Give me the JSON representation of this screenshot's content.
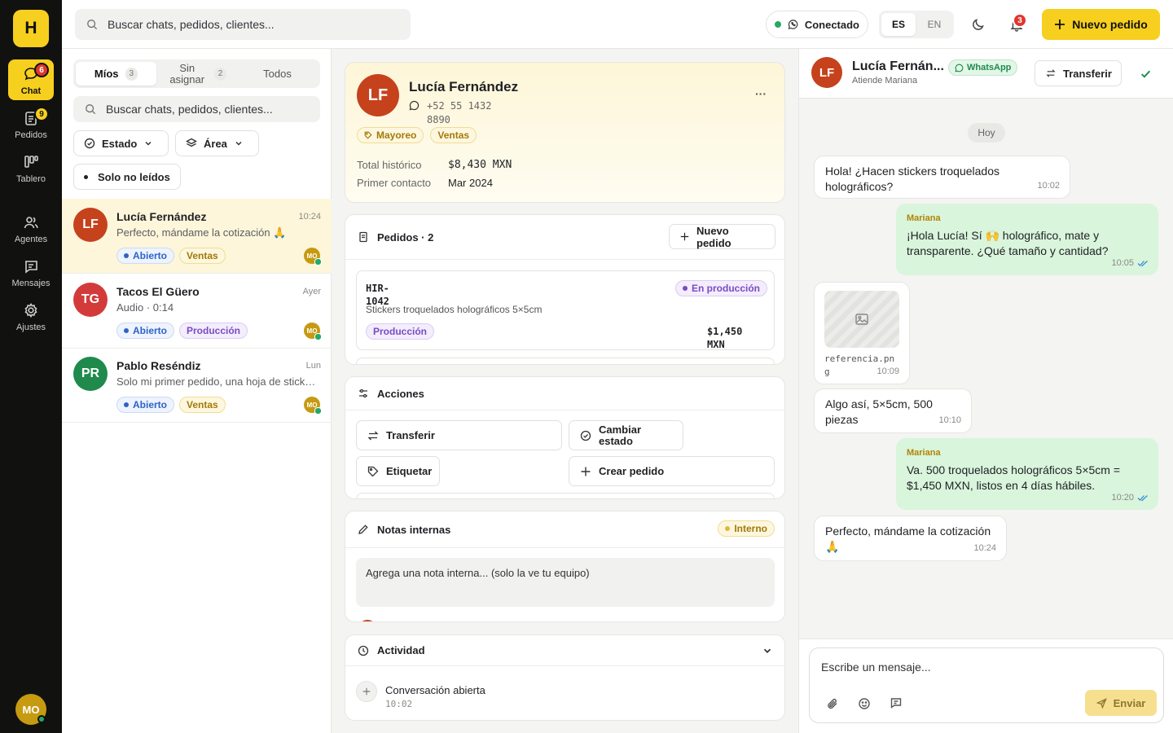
{
  "colors": {
    "accent": "#f7cf1f",
    "rail_bg": "#111110",
    "whatsapp": "#25a866"
  },
  "rail": {
    "logo": "H",
    "items": [
      {
        "label": "Chat",
        "icon": "chat-bubble-icon",
        "badge": "6"
      },
      {
        "label": "Pedidos",
        "icon": "clipboard-icon",
        "badge": "9"
      },
      {
        "label": "Tablero",
        "icon": "kanban-icon"
      },
      {
        "label": "Agentes",
        "icon": "users-icon"
      },
      {
        "label": "Mensajes",
        "icon": "message-square-icon"
      },
      {
        "label": "Ajustes",
        "icon": "gear-icon"
      }
    ],
    "user_initials": "MO"
  },
  "topbar": {
    "search_placeholder": "Buscar chats, pedidos, clientes...",
    "status_label": "Conectado",
    "lang_es": "ES",
    "lang_en": "EN",
    "notifications_count": "3",
    "new_order_label": "Nuevo pedido"
  },
  "list": {
    "tabs": [
      {
        "label": "Míos",
        "count": "3"
      },
      {
        "label": "Sin asignar",
        "count": "2"
      },
      {
        "label": "Todos"
      }
    ],
    "search_placeholder": "Buscar chats, pedidos, clientes...",
    "filter_estado": "Estado",
    "filter_area": "Área",
    "filter_unread": "Solo no leídos",
    "conversations": [
      {
        "initials": "LF",
        "name": "Lucía Fernández",
        "time": "10:24",
        "preview": "Perfecto, mándame la cotización 🙏",
        "status": "Abierto",
        "area": "Ventas",
        "agent": "MO",
        "color": "#c5421d"
      },
      {
        "initials": "TG",
        "name": "Tacos El Güero",
        "time": "Ayer",
        "preview": "Audio · 0:14",
        "status": "Abierto",
        "area": "Producción",
        "agent": "MO",
        "color": "#d33b3b"
      },
      {
        "initials": "PR",
        "name": "Pablo Reséndiz",
        "time": "Lun",
        "preview": "Solo mi primer pedido, una hoja de stickers de prueba",
        "status": "Abierto",
        "area": "Ventas",
        "agent": "MO",
        "color": "#1f8a4c"
      }
    ]
  },
  "customer": {
    "initials": "LF",
    "name": "Lucía Fernández",
    "phone_line1": "+52 55 1432",
    "phone_line2": "8890",
    "tags": [
      "Mayoreo",
      "Ventas"
    ],
    "total_label": "Total histórico",
    "total_value": "$8,430 MXN",
    "first_label": "Primer contacto",
    "first_value": "Mar 2024",
    "more": "···"
  },
  "orders": {
    "title": "Pedidos · 2",
    "new_label": "Nuevo pedido",
    "item": {
      "id_line1": "HIR-",
      "id_line2": "1042",
      "status": "En producción",
      "desc": "Stickers troquelados holográficos 5×5cm",
      "area": "Producción",
      "price_line1": "$1,450",
      "price_line2": "MXN"
    }
  },
  "actions": {
    "title": "Acciones",
    "transfer": "Transferir",
    "change_state_line1": "Cambiar",
    "change_state_line2": "estado",
    "tag": "Etiquetar",
    "create_order": "Crear pedido"
  },
  "notes": {
    "title": "Notas internas",
    "badge": "Interno",
    "placeholder": "Agrega una nota interna... (solo la ve tu equipo)"
  },
  "activity": {
    "title": "Actividad",
    "event": "Conversación abierta",
    "time": "10:02"
  },
  "chat": {
    "name": "Lucía Fernán...",
    "channel": "WhatsApp",
    "agent_line": "Atiende Mariana",
    "transfer_label": "Transferir",
    "day_label": "Hoy",
    "messages": [
      {
        "dir": "in",
        "text": "Hola! ¿Hacen stickers troquelados holográficos?",
        "time": "10:02"
      },
      {
        "dir": "out",
        "sender": "Mariana",
        "text": "¡Hola Lucía! Sí 🙌 holográfico, mate y transparente. ¿Qué tamaño y cantidad?",
        "time": "10:05"
      },
      {
        "dir": "in",
        "file_line1": "referencia.pn",
        "file_line2": "g",
        "time": "10:09"
      },
      {
        "dir": "in",
        "text": "Algo así, 5×5cm, 500 piezas",
        "time": "10:10"
      },
      {
        "dir": "out",
        "sender": "Mariana",
        "text": "Va. 500 troquelados holográficos 5×5cm = $1,450 MXN, listos en 4 días hábiles.",
        "time": "10:20"
      },
      {
        "dir": "in",
        "text": "Perfecto, mándame la cotización 🙏",
        "time": "10:24"
      }
    ],
    "composer_placeholder": "Escribe un mensaje...",
    "send_label": "Enviar"
  }
}
